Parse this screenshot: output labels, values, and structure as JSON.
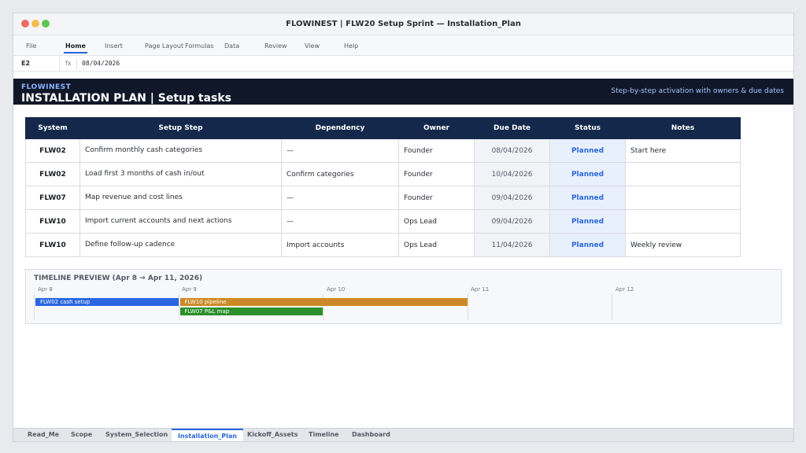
{
  "window": {
    "title": "FLOWINEST | FLW20 Setup Sprint — Installation_Plan",
    "controls": {
      "close": "#ee6a5f",
      "minimize": "#f5bd4f",
      "maximize": "#61c554"
    }
  },
  "ribbon": {
    "tabs": [
      "File",
      "Home",
      "Insert",
      "Page Layout",
      "Formulas",
      "Data",
      "Review",
      "View",
      "Help"
    ],
    "active_tab": "Home"
  },
  "formula_bar": {
    "cell_ref": "E2",
    "fx_label": "fx",
    "value": "08/04/2026"
  },
  "banner": {
    "brand": "FLOWINEST",
    "title": "INSTALLATION PLAN | Setup tasks",
    "subtitle": "Step-by-step activation with owners & due dates"
  },
  "table": {
    "headers": [
      "System",
      "Setup Step",
      "Dependency",
      "Owner",
      "Due Date",
      "Status",
      "Notes"
    ],
    "rows": [
      [
        "FLW02",
        "Confirm monthly cash categories",
        "—",
        "Founder",
        "08/04/2026",
        "Planned",
        "Start here"
      ],
      [
        "FLW02",
        "Load first 3 months of cash in/out",
        "Confirm categories",
        "Founder",
        "10/04/2026",
        "Planned",
        ""
      ],
      [
        "FLW07",
        "Map revenue and cost lines",
        "—",
        "Founder",
        "09/04/2026",
        "Planned",
        ""
      ],
      [
        "FLW10",
        "Import current accounts and next actions",
        "—",
        "Ops Lead",
        "09/04/2026",
        "Planned",
        ""
      ],
      [
        "FLW10",
        "Define follow-up cadence",
        "Import accounts",
        "Ops Lead",
        "11/04/2026",
        "Planned",
        "Weekly review"
      ]
    ]
  },
  "timeline": {
    "title": "TIMELINE PREVIEW (Apr 8 → Apr 11, 2026)",
    "days": [
      "Apr 8",
      "Apr 9",
      "Apr 10",
      "Apr 11",
      "Apr 12"
    ],
    "bars": [
      {
        "label": "FLW02 cash setup",
        "start": 0,
        "end": 1,
        "color": "#2a66e0"
      },
      {
        "label": "FLW10 pipeline",
        "start": 1,
        "end": 3,
        "color": "#cc8a26"
      },
      {
        "label": "FLW07 P&L map",
        "start": 1,
        "end": 2,
        "color": "#2b8f2b"
      }
    ]
  },
  "sheet_tabs": {
    "tabs": [
      "Read_Me",
      "Scope",
      "System_Selection",
      "Installation_Plan",
      "Kickoff_Assets",
      "Timeline",
      "Dashboard"
    ],
    "active": "Installation_Plan"
  }
}
